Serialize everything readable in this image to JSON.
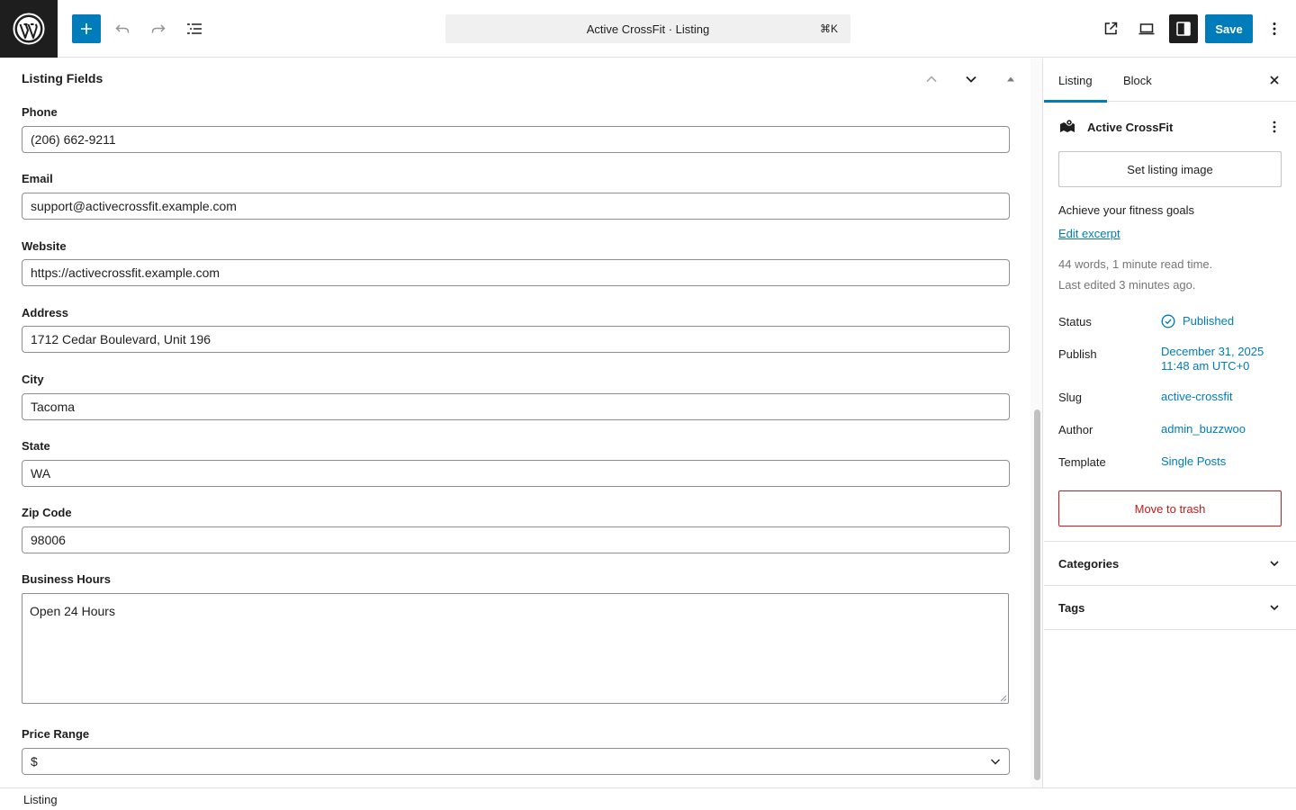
{
  "topbar": {
    "logo": "wordpress-logo",
    "command_title": "Active CrossFit · Listing",
    "command_shortcut": "⌘K",
    "save_label": "Save",
    "accent": "#007cba"
  },
  "main": {
    "section_title": "Listing Fields",
    "fields": [
      {
        "label": "Phone",
        "value": "(206) 662-9211"
      },
      {
        "label": "Email",
        "value": "support@activecrossfit.example.com"
      },
      {
        "label": "Website",
        "value": "https://activecrossfit.example.com"
      },
      {
        "label": "Address",
        "value": "1712 Cedar Boulevard, Unit 196"
      },
      {
        "label": "City",
        "value": "Tacoma"
      },
      {
        "label": "State",
        "value": "WA"
      },
      {
        "label": "Zip Code",
        "value": "98006"
      }
    ],
    "business_hours": {
      "label": "Business Hours",
      "value": "Open 24 Hours"
    },
    "price_range": {
      "label": "Price Range",
      "value": "$"
    }
  },
  "footer": {
    "breadcrumb": "Listing"
  },
  "sidebar": {
    "tabs": [
      "Listing",
      "Block"
    ],
    "post_title": "Active CrossFit",
    "set_image_label": "Set listing image",
    "excerpt": "Achieve your fitness goals",
    "edit_excerpt_label": "Edit excerpt",
    "word_count": "44 words, 1 minute read time.",
    "last_edited": "Last edited 3 minutes ago.",
    "summary": {
      "status_label": "Status",
      "status_value": "Published",
      "publish_label": "Publish",
      "publish_date": "December 31, 2025",
      "publish_time": "11:48 am UTC+0",
      "slug_label": "Slug",
      "slug_value": "active-crossfit",
      "author_label": "Author",
      "author_value": "admin_buzzwoo",
      "template_label": "Template",
      "template_value": "Single Posts"
    },
    "trash_label": "Move to trash",
    "panels": [
      "Categories",
      "Tags"
    ],
    "danger_color": "#cc1818"
  }
}
